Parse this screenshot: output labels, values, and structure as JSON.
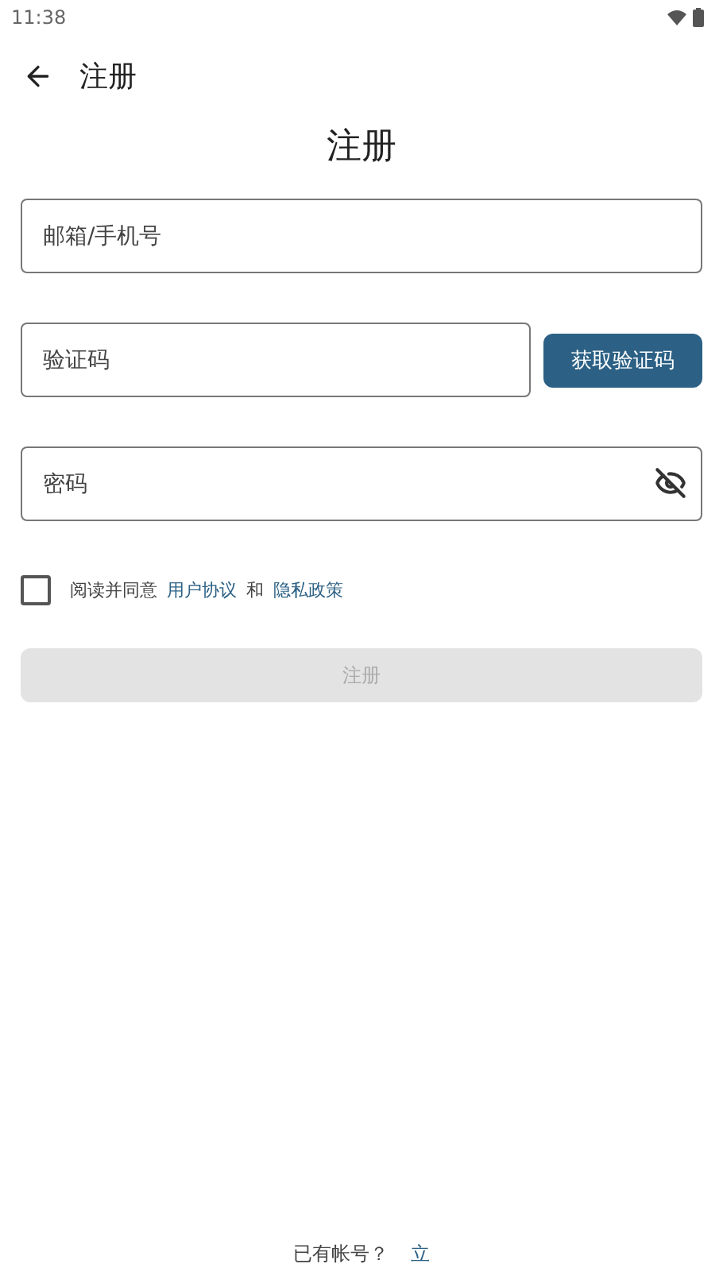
{
  "status_bar": {
    "time": "11:38"
  },
  "toolbar": {
    "title": "注册"
  },
  "heading": "注册",
  "fields": [
    {
      "kind": "text",
      "placeholder": "邮箱/手机号"
    },
    {
      "kind": "code",
      "placeholder": "验证码",
      "button": "获取验证码"
    },
    {
      "kind": "password",
      "placeholder": "密码",
      "password_visible": false
    }
  ],
  "agreement": {
    "checked": false,
    "text": "阅读并同意",
    "link_1": "用户协议",
    "joiner": "和",
    "link_2": "隐私政策"
  },
  "submit": {
    "label": "注册",
    "disabled": true
  },
  "footer": {
    "text": "已有帐号？",
    "link": "立"
  }
}
